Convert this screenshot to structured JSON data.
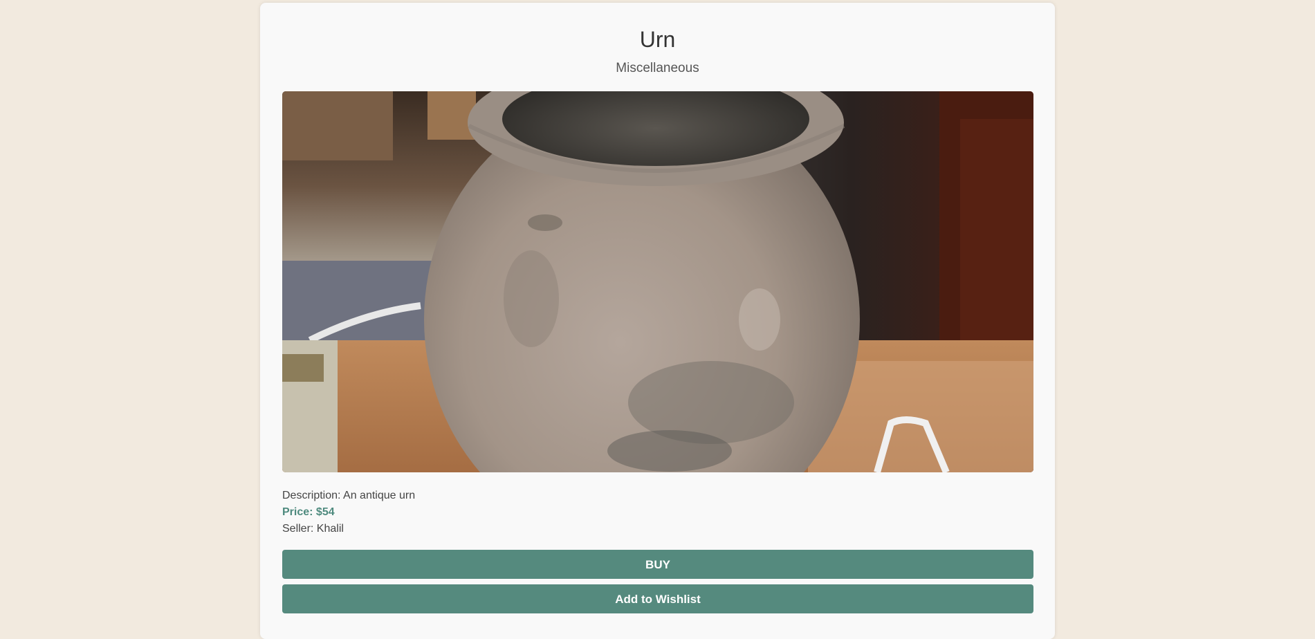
{
  "product": {
    "title": "Urn",
    "category": "Miscellaneous",
    "description": "Description: An antique urn",
    "price": "Price: $54",
    "seller": "Seller: Khalil"
  },
  "actions": {
    "buy_label": "BUY",
    "wishlist_label": "Add to Wishlist"
  },
  "colors": {
    "page_background": "#f2eadf",
    "card_background": "#f9f9f9",
    "accent": "#558a7e",
    "price_text": "#4e8a7e"
  }
}
